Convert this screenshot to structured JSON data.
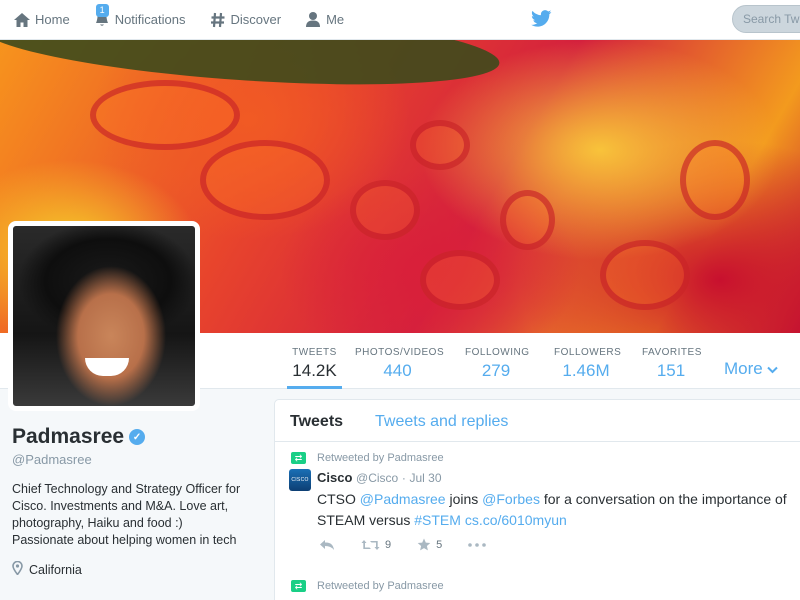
{
  "nav": {
    "home": "Home",
    "notifications": "Notifications",
    "notifications_badge": "1",
    "discover": "Discover",
    "me": "Me",
    "search_placeholder": "Search Twitter"
  },
  "stats": [
    {
      "label": "TWEETS",
      "value": "14.2K"
    },
    {
      "label": "PHOTOS/VIDEOS",
      "value": "440"
    },
    {
      "label": "FOLLOWING",
      "value": "279"
    },
    {
      "label": "FOLLOWERS",
      "value": "1.46M"
    },
    {
      "label": "FAVORITES",
      "value": "151"
    }
  ],
  "more_label": "More",
  "profile": {
    "name": "Padmasree",
    "handle": "@Padmasree",
    "bio": "Chief Technology and Strategy Officer for Cisco. Investments and M&A. Love art, photography, Haiku and food :) Passionate about helping women in tech",
    "location": "California"
  },
  "tabs": {
    "tweets": "Tweets",
    "replies": "Tweets and replies"
  },
  "tweets": [
    {
      "retweeted_by": "Retweeted by Padmasree",
      "author": "Cisco",
      "handle": "@Cisco",
      "separator": "·",
      "date": "Jul 30",
      "avatar_text": "CISCO",
      "text_parts": {
        "p1": "CTSO ",
        "m1": "@Padmasree",
        "p2": " joins ",
        "m2": "@Forbes",
        "p3": " for a conversation on the importance of STEAM versus ",
        "h1": "#STEM",
        "p4": " ",
        "l1": "cs.co/6010myun"
      },
      "retweets": "9",
      "favorites": "5"
    },
    {
      "retweeted_by": "Retweeted by Padmasree"
    }
  ],
  "colors": {
    "accent": "#55acee",
    "retweet": "#19cf86",
    "text": "#292f33",
    "muted": "#8899a6"
  },
  "icons": [
    "home-icon",
    "bell-icon",
    "hashtag-icon",
    "user-icon",
    "twitter-bird-icon",
    "verified-icon",
    "location-pin-icon",
    "reply-icon",
    "retweet-icon",
    "favorite-icon",
    "more-dots-icon",
    "chevron-down-icon"
  ]
}
